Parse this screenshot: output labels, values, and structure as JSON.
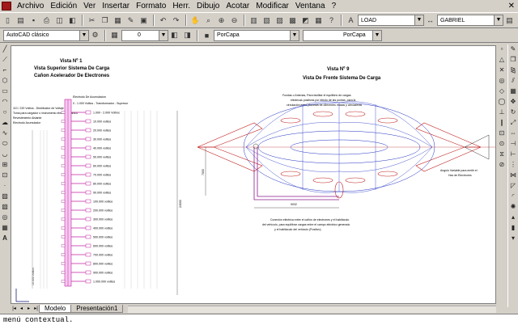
{
  "menu": {
    "items": [
      "Archivo",
      "Edición",
      "Ver",
      "Insertar",
      "Formato",
      "Herr.",
      "Dibujo",
      "Acotar",
      "Modificar",
      "Ventana",
      "?"
    ]
  },
  "toolbar": {
    "textstyle_value": "LOAD",
    "dimstyle_value": "GABRIEL",
    "workspace_value": "AutoCAD clásico",
    "layer_value": "0",
    "color_value": "PorCapa",
    "linetype_value": "PorCapa"
  },
  "drawing": {
    "left_title": [
      "Vista Nº 1",
      "Vista Superior Sistema De Carga",
      "Cañon Acelerador De Electrones"
    ],
    "right_title": [
      "Vista Nº 9",
      "Vista De Frente Sistema De Carga"
    ],
    "legend": [
      "110 / 220 Voltios - Distribuidor de Voltaje",
      "Toma para cargador o instrumento electromecanico",
      "Revestimiento Aislante",
      "Electrodo Acumulador"
    ],
    "header_notes": [
      "0 - 1.000 Voltios - Transformador - Supresor",
      "Electrodo De Acumulacion"
    ],
    "side_label": "10.000 Voltios",
    "voltage_labels": [
      "1.000 - 2.000 Voltios",
      "10.000 voltios",
      "20.000 voltios",
      "30.000 voltios",
      "40.000 voltios",
      "50.000 voltios",
      "60.000 voltios",
      "70.000 voltios",
      "80.000 voltios",
      "90.000 voltios",
      "100.000 voltios",
      "200.000 voltios",
      "300.000 voltios",
      "400.000 voltios",
      "500.000 voltios",
      "600.000 voltios",
      "700.000 voltios",
      "800.000 voltios",
      "900.000 voltios",
      "1.000.000 voltios"
    ],
    "callout_top": [
      "Fundas o Antenas, Para facilitar el equilibrio de cargas",
      "eléctricas positivas por efecto de las puntas, para la",
      "circulación entre planetas de diferentes masas y atmósferas"
    ],
    "callout_right": [
      "Angulo Variable para emitir el",
      "Haz de Electrones"
    ],
    "callout_bottom": [
      "Conexión eléctrica entre el cañón de electrones y el habitáculo",
      "del vehículo, para equilibrar cargas entre el campo eléctrico generado",
      "y el habitáculo del vehículo (Positivo)"
    ],
    "dim_left": "7000",
    "dim_bottom": "9032",
    "dim_total": "24000"
  },
  "layout_tabs": [
    "Modelo",
    "Presentación1"
  ],
  "command_line": "menú contextual."
}
